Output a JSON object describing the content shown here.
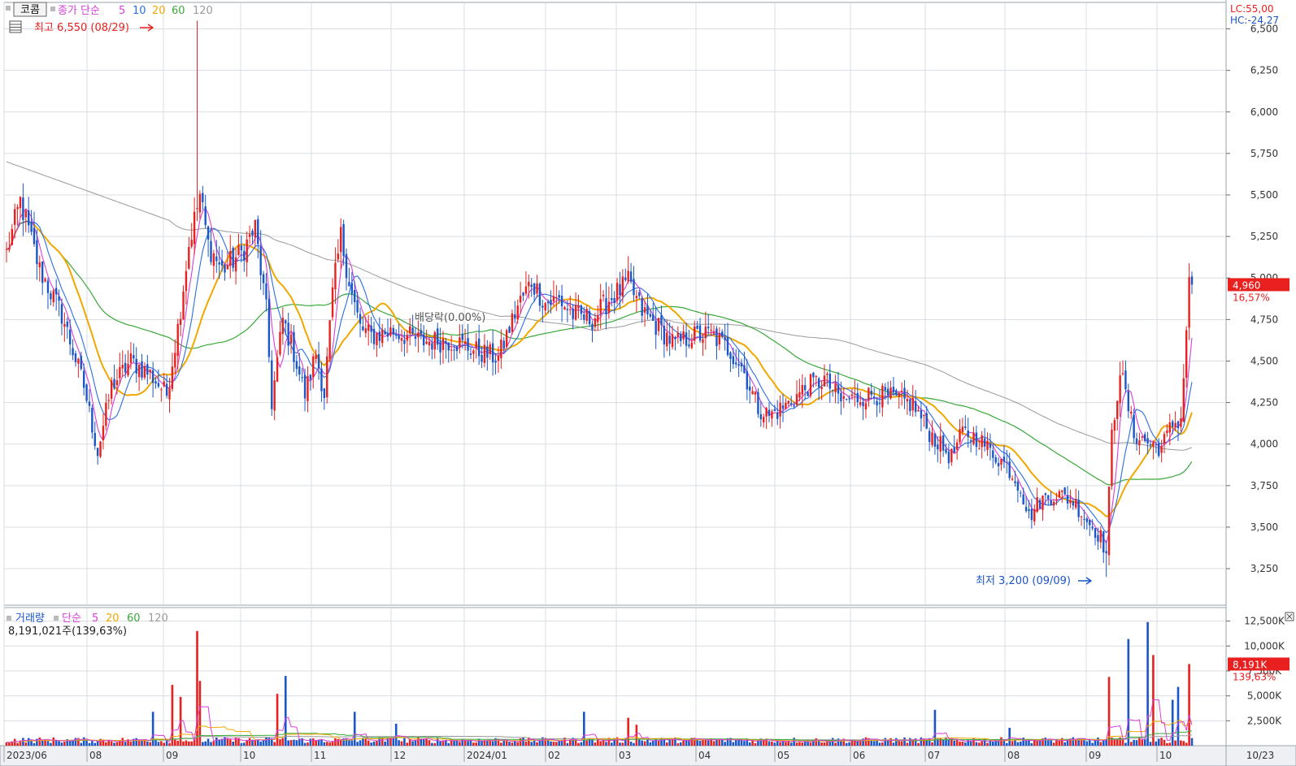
{
  "header": {
    "stock_name": "코콤",
    "price_legend_label": "종가 단순",
    "ma_periods": [
      "5",
      "10",
      "20",
      "60",
      "120"
    ],
    "lc_text": "LC:55,00",
    "hc_text": "HC:-24,27"
  },
  "annotations": {
    "high_text": "최고 6,550 (08/29)",
    "low_text": "최저 3,200 (09/09)",
    "dividend_text": "배당락(0.00%)"
  },
  "current": {
    "price_text": "4,960",
    "change_text": "16,57%",
    "volume_text": "8,191K",
    "volume_pct_text": "139,63%"
  },
  "volume_header": {
    "label": "거래량",
    "legend_label": "단순",
    "ma_periods": [
      "5",
      "20",
      "60",
      "120"
    ],
    "summary": "8,191,021주(139,63%)"
  },
  "colors": {
    "up": "#e8201f",
    "down": "#1a56c8",
    "ma5": "#d83fd8",
    "ma10": "#2a6fe0",
    "ma20": "#f0a800",
    "ma60": "#3aa83a",
    "ma120": "#9a9a9a",
    "grid": "#d8dde2",
    "price_tag_bg": "#e8201f"
  },
  "chart_data": {
    "type": "candlestick",
    "title": "",
    "x_tick_labels": [
      "2023/06",
      "08",
      "09",
      "10",
      "11",
      "12",
      "2024/01",
      "02",
      "03",
      "04",
      "05",
      "06",
      "07",
      "08",
      "09",
      "10",
      "10/23"
    ],
    "price_axis": {
      "ticks": [
        3250,
        3500,
        3750,
        4000,
        4250,
        4500,
        4750,
        5000,
        5250,
        5500,
        5750,
        6000,
        6250,
        6500
      ],
      "range": [
        3040,
        6620
      ]
    },
    "volume_axis": {
      "ticks": [
        2500,
        5000,
        7500,
        10000,
        12500
      ],
      "tick_labels": [
        "2,500K",
        "5,000K",
        "7,500K",
        "10,000K",
        "12,500K"
      ],
      "range": [
        0,
        13200
      ],
      "unit": "K"
    },
    "series_keys": [
      {
        "name": "5",
        "type": "line"
      },
      {
        "name": "10",
        "type": "line"
      },
      {
        "name": "20",
        "type": "line"
      },
      {
        "name": "60",
        "type": "line"
      },
      {
        "name": "120",
        "type": "line"
      }
    ],
    "price_waypoints": [
      [
        0,
        5150
      ],
      [
        5,
        5460
      ],
      [
        12,
        5050
      ],
      [
        20,
        4780
      ],
      [
        28,
        4350
      ],
      [
        33,
        3950
      ],
      [
        38,
        4350
      ],
      [
        45,
        4500
      ],
      [
        52,
        4420
      ],
      [
        58,
        4300
      ],
      [
        62,
        4700
      ],
      [
        66,
        5200
      ],
      [
        70,
        5500
      ],
      [
        73,
        5200
      ],
      [
        78,
        5050
      ],
      [
        85,
        5150
      ],
      [
        90,
        5300
      ],
      [
        94,
        4800
      ],
      [
        96,
        4250
      ],
      [
        100,
        4750
      ],
      [
        104,
        4550
      ],
      [
        108,
        4300
      ],
      [
        112,
        4550
      ],
      [
        115,
        4300
      ],
      [
        118,
        4900
      ],
      [
        121,
        5250
      ],
      [
        125,
        4900
      ],
      [
        128,
        4700
      ],
      [
        132,
        4650
      ],
      [
        140,
        4680
      ],
      [
        150,
        4620
      ],
      [
        162,
        4620
      ],
      [
        170,
        4560
      ],
      [
        178,
        4520
      ],
      [
        185,
        4830
      ],
      [
        190,
        4980
      ],
      [
        195,
        4850
      ],
      [
        200,
        4870
      ],
      [
        205,
        4780
      ],
      [
        212,
        4750
      ],
      [
        218,
        4870
      ],
      [
        225,
        4970
      ],
      [
        230,
        4800
      ],
      [
        236,
        4700
      ],
      [
        242,
        4600
      ],
      [
        248,
        4650
      ],
      [
        255,
        4660
      ],
      [
        262,
        4560
      ],
      [
        266,
        4470
      ],
      [
        272,
        4220
      ],
      [
        276,
        4170
      ],
      [
        282,
        4230
      ],
      [
        290,
        4350
      ],
      [
        296,
        4390
      ],
      [
        302,
        4260
      ],
      [
        308,
        4280
      ],
      [
        314,
        4300
      ],
      [
        320,
        4280
      ],
      [
        328,
        4240
      ],
      [
        334,
        4070
      ],
      [
        338,
        3990
      ],
      [
        342,
        3920
      ],
      [
        346,
        4070
      ],
      [
        352,
        4030
      ],
      [
        356,
        3960
      ],
      [
        362,
        3870
      ],
      [
        367,
        3740
      ],
      [
        370,
        3560
      ],
      [
        374,
        3660
      ],
      [
        380,
        3700
      ],
      [
        386,
        3660
      ],
      [
        392,
        3520
      ],
      [
        396,
        3440
      ],
      [
        398,
        3340
      ],
      [
        400,
        4050
      ],
      [
        403,
        4450
      ],
      [
        408,
        4060
      ],
      [
        414,
        4000
      ],
      [
        418,
        3980
      ],
      [
        422,
        4120
      ],
      [
        425,
        4150
      ],
      [
        428,
        4960
      ]
    ],
    "volume_spikes": [
      [
        53,
        3400
      ],
      [
        60,
        6100
      ],
      [
        63,
        4900
      ],
      [
        69,
        11500
      ],
      [
        70,
        6500
      ],
      [
        98,
        5200
      ],
      [
        101,
        7000
      ],
      [
        126,
        3400
      ],
      [
        141,
        2200
      ],
      [
        209,
        3400
      ],
      [
        225,
        2800
      ],
      [
        228,
        2100
      ],
      [
        336,
        3600
      ],
      [
        363,
        1800
      ],
      [
        399,
        6900
      ],
      [
        406,
        10700
      ],
      [
        413,
        12400
      ],
      [
        415,
        9100
      ],
      [
        422,
        4600
      ],
      [
        424,
        5900
      ],
      [
        428,
        8191
      ]
    ],
    "high_marker": {
      "index": 69,
      "value": 6550,
      "date": "08/29"
    },
    "low_marker": {
      "index": 398,
      "value": 3200,
      "date": "09/09"
    },
    "last_close": 4960,
    "last_change_pct": 16.57,
    "last_volume_k": 8191,
    "last_volume_pct": 139.63
  }
}
